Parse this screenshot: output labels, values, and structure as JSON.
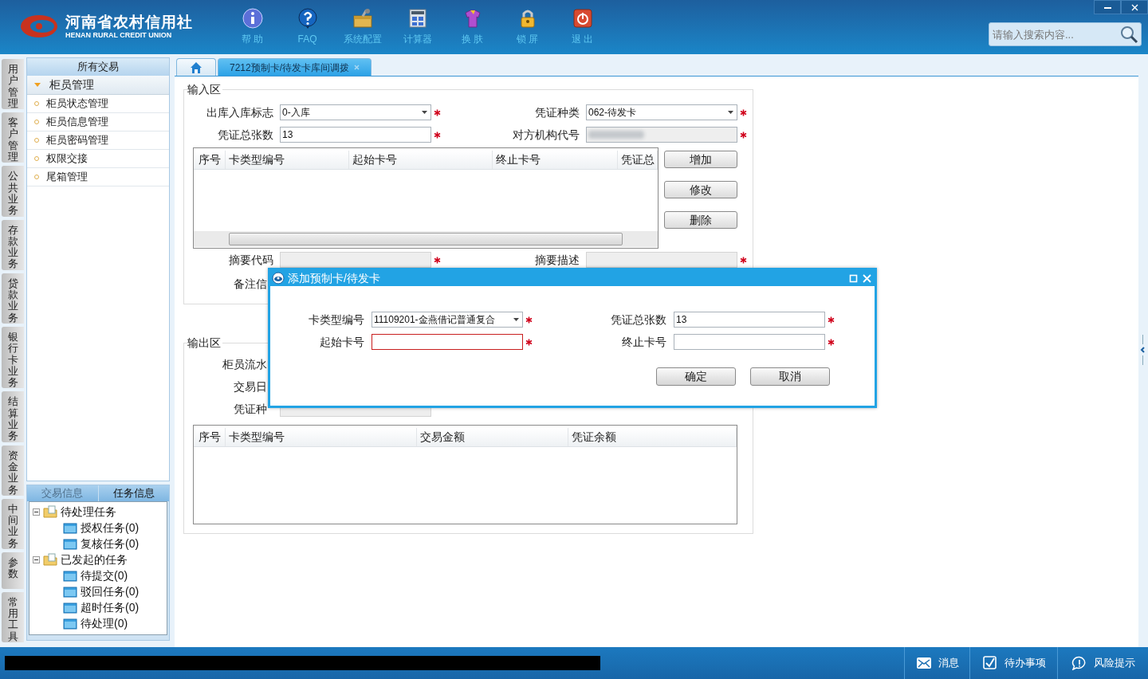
{
  "header": {
    "logo": {
      "name": "河南省农村信用社",
      "subtitle": "HENAN RURAL CREDIT UNION"
    },
    "toolbar": [
      {
        "kind": "info",
        "label": "帮 助"
      },
      {
        "kind": "help",
        "label": "FAQ"
      },
      {
        "kind": "toolbox",
        "label": "系统配置"
      },
      {
        "kind": "calculator",
        "label": "计算器"
      },
      {
        "kind": "shirt",
        "label": "换 肤"
      },
      {
        "kind": "lock",
        "label": "锁 屏"
      },
      {
        "kind": "power",
        "label": "退 出"
      }
    ],
    "search": {
      "placeholder": "请输入搜索内容..."
    }
  },
  "side_tabs": [
    "用户管理",
    "客户管理",
    "公共业务",
    "存款业务",
    "贷款业务",
    "银行卡业务",
    "结算业务",
    "资金业务",
    "中间业务",
    "参数",
    "常用工具"
  ],
  "nav_panel": {
    "title": "所有交易",
    "group": {
      "label": "柜员管理",
      "expanded": true
    },
    "items": [
      "柜员状态管理",
      "柜员信息管理",
      "柜员密码管理",
      "权限交接",
      "尾箱管理"
    ]
  },
  "task_panel": {
    "tabs": [
      {
        "label": "交易信息",
        "selected": false
      },
      {
        "label": "任务信息",
        "selected": true
      }
    ],
    "tree": [
      {
        "label": "待处理任务",
        "expanded": true,
        "children": [
          {
            "label": "授权任务(0)"
          },
          {
            "label": "复核任务(0)"
          }
        ]
      },
      {
        "label": "已发起的任务",
        "expanded": true,
        "children": [
          {
            "label": "待提交(0)"
          },
          {
            "label": "驳回任务(0)"
          },
          {
            "label": "超时任务(0)"
          },
          {
            "label": "待处理(0)"
          }
        ]
      }
    ]
  },
  "tabs": [
    {
      "kind": "home",
      "selected": false
    },
    {
      "kind": "page",
      "label": "7212预制卡/待发卡库间调拨",
      "selected": true
    }
  ],
  "input_area": {
    "title": "输入区",
    "rows": [
      [
        {
          "label": "出库入库标志",
          "kind": "select",
          "value": "0-入库",
          "required": true
        },
        {
          "label": "凭证种类",
          "kind": "select",
          "value": "062-待发卡",
          "required": true
        }
      ],
      [
        {
          "label": "凭证总张数",
          "kind": "text",
          "value": "13",
          "required": true
        },
        {
          "label": "对方机构代号",
          "kind": "blurred",
          "required": true
        }
      ]
    ],
    "grid": {
      "columns": [
        "序号",
        "卡类型编号",
        "起始卡号",
        "终止卡号",
        "凭证总"
      ]
    },
    "buttons": [
      "增加",
      "修改",
      "删除"
    ],
    "rows2": [
      [
        {
          "label": "摘要代码",
          "kind": "readonly",
          "required": true
        },
        {
          "label": "摘要描述",
          "kind": "readonly",
          "required": true
        }
      ],
      [
        {
          "label": "备注信",
          "kind": "readonly",
          "required": false
        }
      ]
    ]
  },
  "output_area": {
    "title": "输出区",
    "rows": [
      "柜员流水",
      "交易日",
      "凭证种"
    ],
    "grid": {
      "columns": [
        "序号",
        "卡类型编号",
        "交易金额",
        "凭证余额"
      ]
    }
  },
  "dialog": {
    "title": "添加预制卡/待发卡",
    "rows": [
      [
        {
          "label": "卡类型编号",
          "kind": "select",
          "value": "11109201-金燕借记普通复合",
          "required": true,
          "error": false
        },
        {
          "label": "凭证总张数",
          "kind": "text",
          "value": "13",
          "required": true,
          "error": false
        }
      ],
      [
        {
          "label": "起始卡号",
          "kind": "text",
          "required": true,
          "error": true
        },
        {
          "label": "终止卡号",
          "kind": "text",
          "required": true,
          "error": false
        }
      ]
    ],
    "buttons": [
      "确定",
      "取消"
    ]
  },
  "status_bar": {
    "items": [
      {
        "kind": "mail",
        "label": "消息"
      },
      {
        "kind": "check",
        "label": "待办事项"
      },
      {
        "kind": "bubble",
        "label": "风险提示"
      }
    ]
  }
}
